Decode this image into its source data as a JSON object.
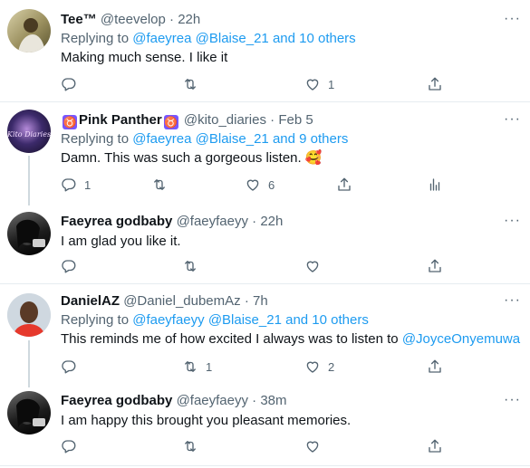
{
  "tweets": [
    {
      "name": "Tee™",
      "handle": "@teevelop",
      "dot": "·",
      "time": "22h",
      "replying_prefix": "Replying to",
      "replying_users": "@faeyrea @Blaise_21",
      "replying_others": "and 10 others",
      "text": "Making much sense. I like it",
      "reply_count": "",
      "retweet_count": "",
      "like_count": "1"
    },
    {
      "name": "Pink Panther",
      "name_badge": "♉",
      "handle": "@kito_diaries",
      "dot": "·",
      "time": "Feb 5",
      "avatar_text": "Kito Diaries",
      "replying_prefix": "Replying to",
      "replying_users": "@faeyrea @Blaise_21",
      "replying_others": "and 9 others",
      "text": "Damn. This was such a gorgeous listen.",
      "emoji": "🥰",
      "reply_count": "1",
      "retweet_count": "",
      "like_count": "6"
    },
    {
      "name": "Faeyrea godbaby",
      "handle": "@faeyfaeyy",
      "dot": "·",
      "time": "22h",
      "text": "I am glad you like it.",
      "reply_count": "",
      "retweet_count": "",
      "like_count": ""
    },
    {
      "name": "DanielAZ",
      "handle": "@Daniel_dubemAz",
      "dot": "·",
      "time": "7h",
      "replying_prefix": "Replying to",
      "replying_users": "@faeyfaeyy @Blaise_21",
      "replying_others": "and 10 others",
      "text": "This reminds me of how excited I always was to listen to",
      "mention": "@JoyceOnyemuwa",
      "reply_count": "",
      "retweet_count": "1",
      "like_count": "2"
    },
    {
      "name": "Faeyrea godbaby",
      "handle": "@faeyfaeyy",
      "dot": "·",
      "time": "38m",
      "text": "I am happy this brought you pleasant memories.",
      "reply_count": "",
      "retweet_count": "",
      "like_count": ""
    }
  ],
  "more_label": "···",
  "icons": [
    "reply-icon",
    "retweet-icon",
    "like-icon",
    "share-icon",
    "analytics-icon",
    "more-icon"
  ],
  "colors": {
    "link": "#1d9bf0",
    "muted": "#536471",
    "text": "#0f1419",
    "separator": "#e6ecf0"
  }
}
